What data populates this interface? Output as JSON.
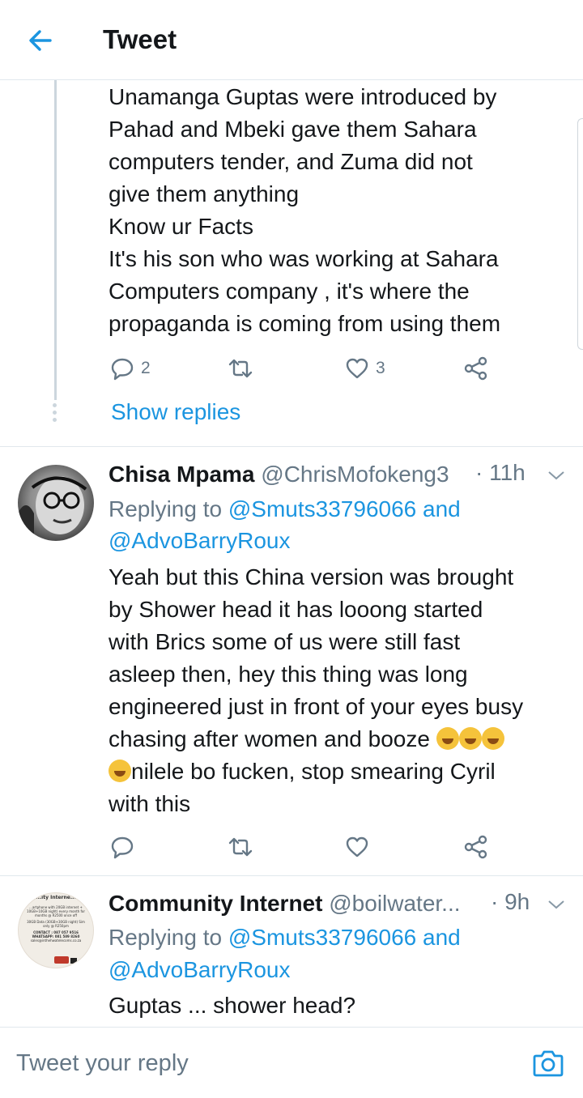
{
  "header": {
    "title": "Tweet"
  },
  "tweet1": {
    "lines": [
      "Unamanga Guptas were introduced  by",
      "Pahad and Mbeki gave them Sahara",
      "computers  tender,  and Zuma did not",
      "give them anything",
      "Know ur Facts",
      "It's his son who was working  at Sahara",
      "Computers  company , it's where the",
      "propaganda  is coming from using them"
    ],
    "reply_count": "2",
    "like_count": "3",
    "show_replies": "Show replies"
  },
  "tweet2": {
    "name": "Chisa Mpama",
    "handle": "@ChrisMofokeng3",
    "time": "· 11h",
    "replying_prefix": "Replying to",
    "mention1": "@Smuts33796066",
    "and": "and",
    "mention2": "@AdvoBarryRoux",
    "lines": [
      "Yeah but this China version was brought",
      "by Shower head it has looong started",
      "with Brics some of us were still fast",
      "asleep then, hey this thing was long",
      "engineered just in front of your eyes busy",
      "chasing after women and booze",
      "nilele bo fucken, stop smearing Cyril",
      "with this"
    ]
  },
  "tweet3": {
    "name": "Community Internet",
    "handle": "@boilwater...",
    "time": "· 9h",
    "replying_prefix": "Replying to",
    "mention1": "@Smuts33796066",
    "and": "and",
    "mention2": "@AdvoBarryRoux",
    "lines": [
      "Guptas ... shower head?"
    ],
    "avatar_text": {
      "t1": "...ity Interne...",
      "t2": "...artphone with 20GB internet +",
      "t3": "10GB+10GB night) every month for",
      "t4": "months @ R2500 once off",
      "t5": "30GB Data (30GB+30GB night) Sim",
      "t6": "only @ R250pm",
      "t7": "CONTACT : 087 057 9516",
      "t8": "WHATSAPP: 081 589 8260",
      "t9": "sales@inthehwatelecoms.co.za"
    }
  },
  "compose": {
    "placeholder": "Tweet your reply"
  },
  "colors": {
    "accent": "#1b95e0",
    "muted": "#657786",
    "text": "#14171a"
  },
  "icons": [
    "back-arrow-icon",
    "reply-icon",
    "retweet-icon",
    "like-icon",
    "share-icon",
    "chevron-down-icon",
    "camera-icon",
    "rofl-emoji"
  ]
}
